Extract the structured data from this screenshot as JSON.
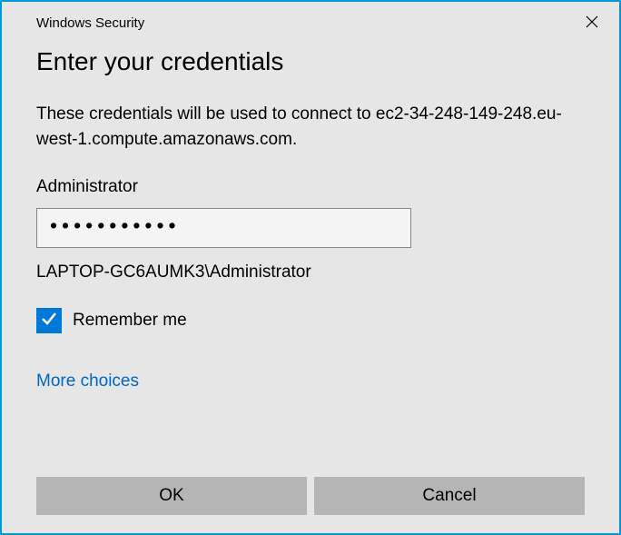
{
  "titlebar": {
    "title": "Windows Security"
  },
  "heading": "Enter your credentials",
  "description": "These credentials will be used to connect to ec2-34-248-149-248.eu-west-1.compute.amazonaws.com.",
  "username": "Administrator",
  "password_masked": "●●●●●●●●●●●",
  "identity": "LAPTOP-GC6AUMK3\\Administrator",
  "remember": {
    "checked": true,
    "label": "Remember me"
  },
  "more_choices": "More choices",
  "buttons": {
    "ok": "OK",
    "cancel": "Cancel"
  },
  "colors": {
    "accent": "#0078d7",
    "border": "#0099d8",
    "link": "#0067c0"
  }
}
